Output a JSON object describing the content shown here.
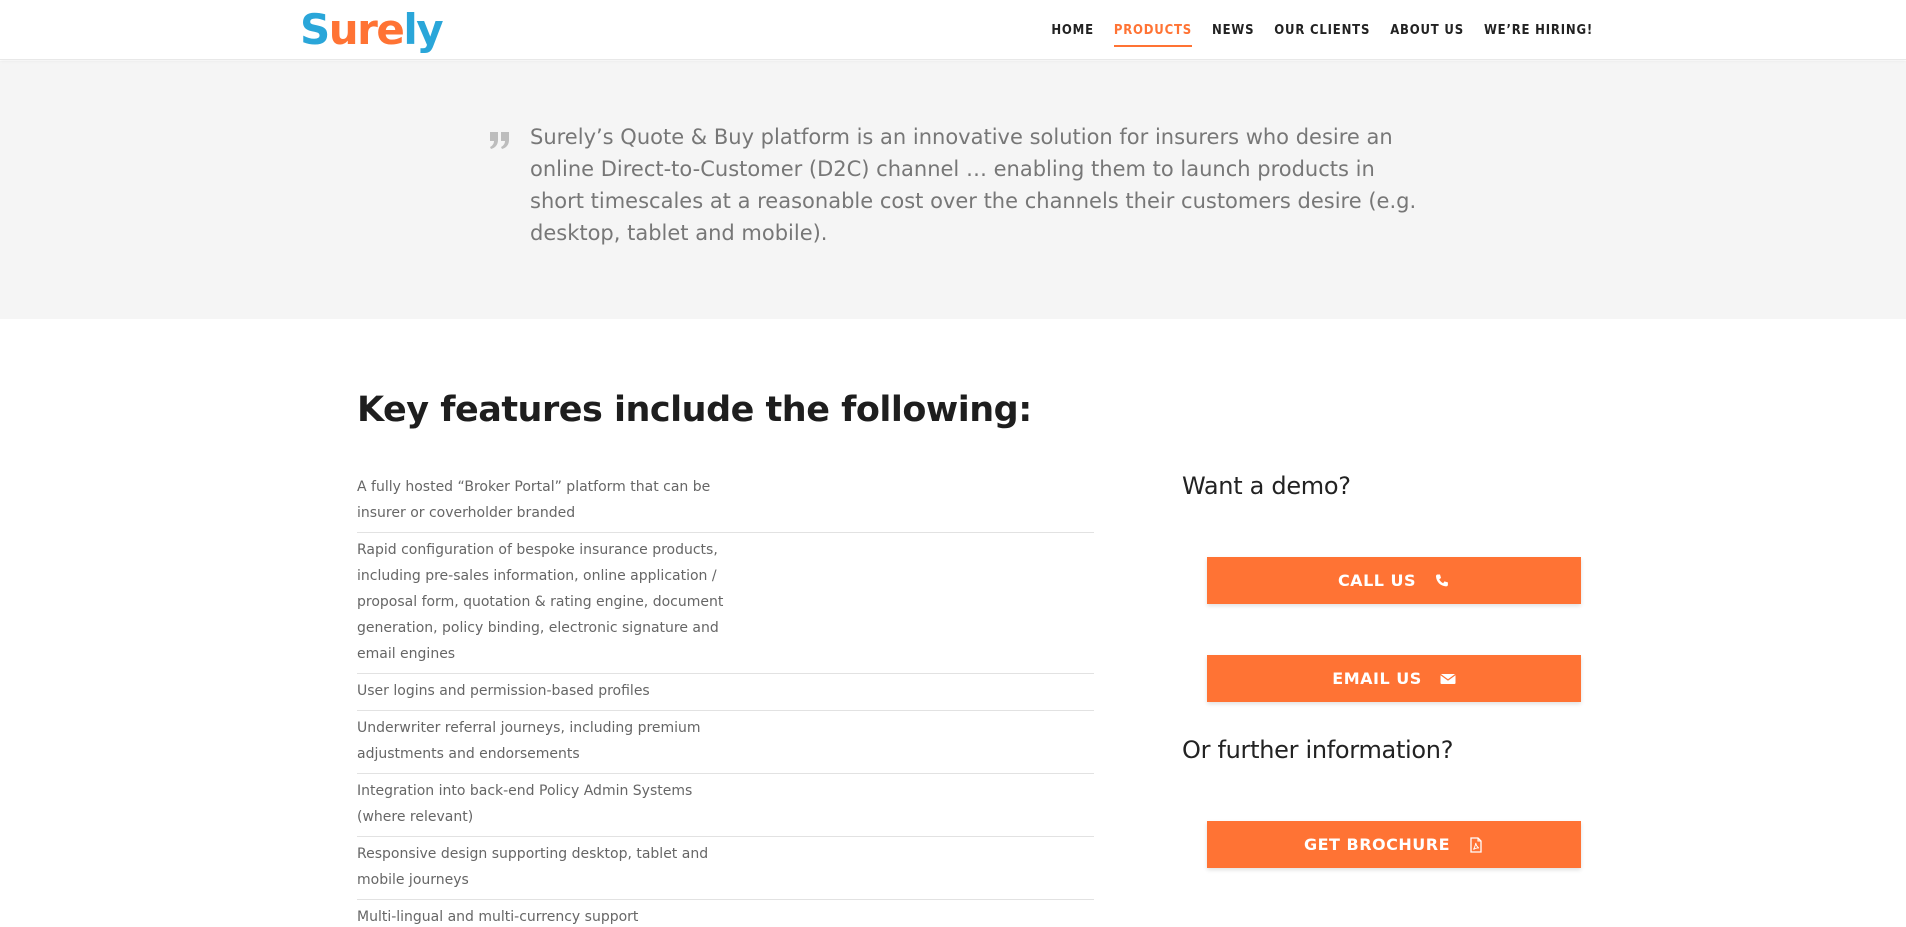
{
  "header": {
    "logo": {
      "s": "S",
      "ure": "ure",
      "ly": "ly"
    },
    "nav": [
      {
        "label": "HOME",
        "active": false
      },
      {
        "label": "PRODUCTS",
        "active": true
      },
      {
        "label": "NEWS",
        "active": false
      },
      {
        "label": "OUR CLIENTS",
        "active": false
      },
      {
        "label": "ABOUT US",
        "active": false
      },
      {
        "label": "WE’RE HIRING!",
        "active": false
      }
    ]
  },
  "quote": {
    "text": "Surely’s Quote & Buy platform is an innovative solution for insurers who desire an online Direct-to-Customer (D2C) channel … enabling them to launch products in short timescales at a reasonable cost over the channels their customers desire (e.g. desktop, tablet and mobile).",
    "icon": "quote-icon"
  },
  "main": {
    "title": "Key features include the following:",
    "features": [
      "A fully hosted “Broker Portal” platform that can be insurer or coverholder branded",
      "Rapid configuration of bespoke insurance products, including pre-sales information, online application / proposal form, quotation & rating engine, document generation, policy binding, electronic signature and email engines",
      "User logins and permission-based profiles",
      "Underwriter referral journeys, including premium adjustments and endorsements",
      "Integration into back-end Policy Admin Systems (where relevant)",
      "Responsive design supporting desktop, tablet and mobile journeys",
      "Multi-lingual and multi-currency support"
    ]
  },
  "sidebar": {
    "demo_heading": "Want a demo?",
    "call_label": "CALL US",
    "call_icon": "phone-icon",
    "email_label": "EMAIL US",
    "email_icon": "envelope-icon",
    "info_heading": "Or further information?",
    "brochure_label": "GET BROCHURE",
    "brochure_icon": "pdf-file-icon"
  },
  "colors": {
    "accent": "#ff7334",
    "brand_blue": "#2aa6d9",
    "quote_band": "#f5f5f5"
  }
}
